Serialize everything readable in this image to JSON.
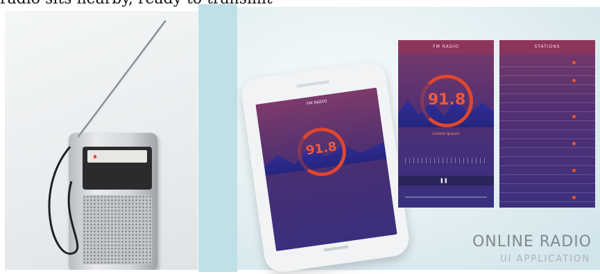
{
  "top_clip_text": "radio sits nearby, ready to transmit",
  "brand": {
    "title": "ONLINE RADIO",
    "subtitle": "UI APPLICATION"
  },
  "phone": {
    "frequency": "91.8",
    "screen_title": "FM RADIO"
  },
  "screen_fm": {
    "title": "FM RADIO",
    "frequency": "91.8",
    "caption": "Lorem Ipsum"
  },
  "screen_stations": {
    "title": "STATIONS"
  },
  "colors": {
    "accent": "#e8552e",
    "purple": "#4a2f72"
  }
}
